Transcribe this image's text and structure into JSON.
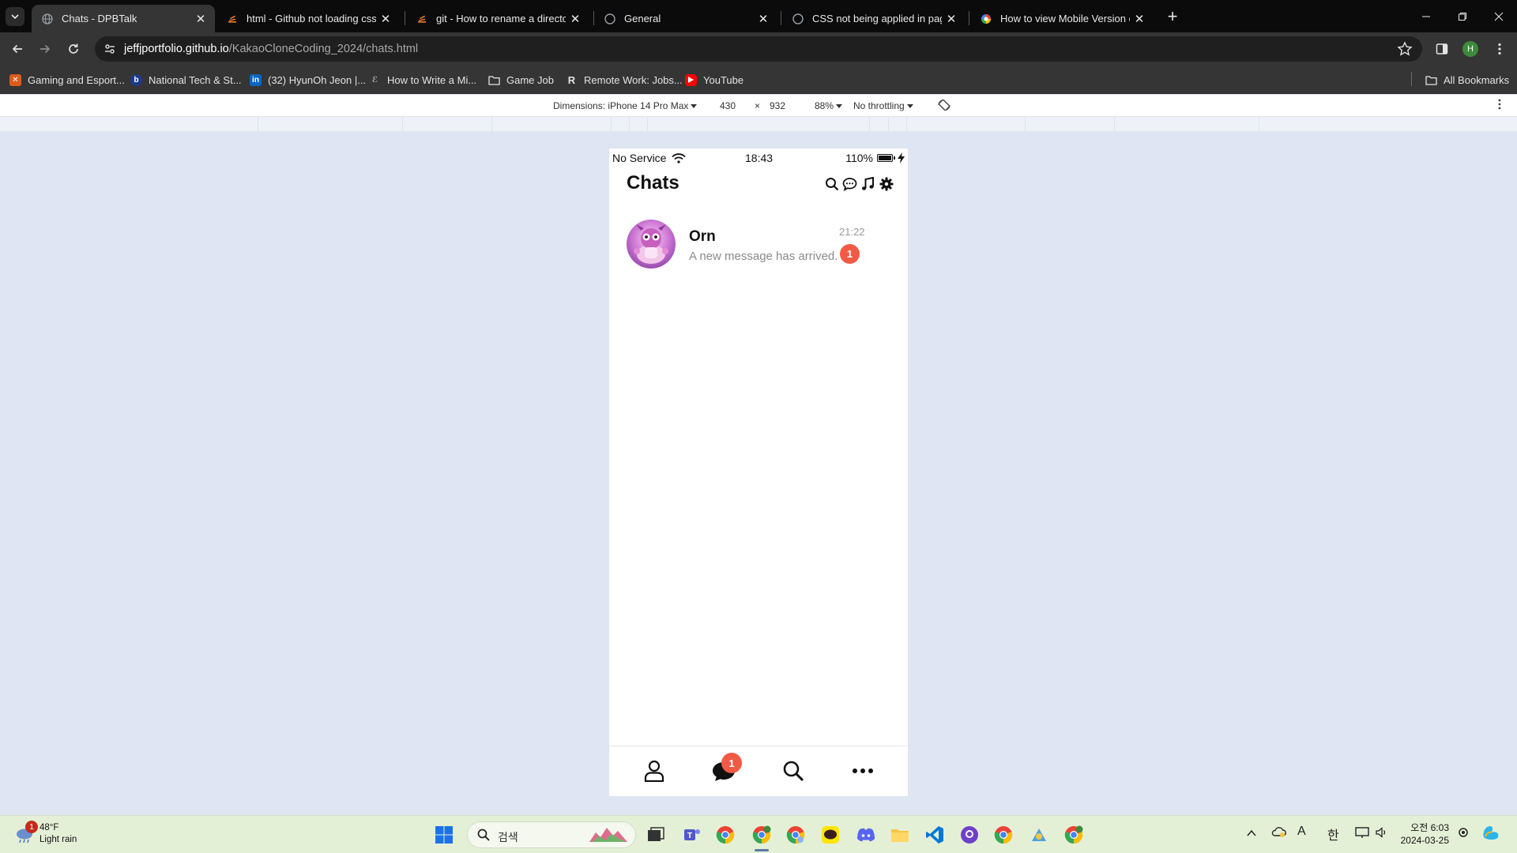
{
  "browser": {
    "tabs": [
      {
        "title": "Chats - DPBTalk",
        "active": true
      },
      {
        "title": "html - Github not loading css",
        "active": false
      },
      {
        "title": "git - How to rename a directo",
        "active": false
      },
      {
        "title": "General",
        "active": false
      },
      {
        "title": "CSS not being applied in page",
        "active": false
      },
      {
        "title": "How to view Mobile Version o",
        "active": false
      }
    ],
    "url_host": "jeffjportfolio.github.io",
    "url_path": "/KakaoCloneCoding_2024/chats.html",
    "profile_initial": "H",
    "bookmarks": [
      {
        "label": "Gaming and Esport..."
      },
      {
        "label": "National Tech & St..."
      },
      {
        "label": "(32) HyunOh Jeon |..."
      },
      {
        "label": "How to Write a Mi..."
      },
      {
        "label": "Game Job"
      },
      {
        "label": "Remote Work: Jobs..."
      },
      {
        "label": "YouTube"
      }
    ],
    "all_bookmarks": "All Bookmarks"
  },
  "devtools": {
    "dimensions_label": "Dimensions: iPhone 14 Pro Max",
    "width": "430",
    "times": "×",
    "height": "932",
    "zoom": "88%",
    "throttling": "No throttling"
  },
  "phone": {
    "status": {
      "carrier": "No Service",
      "time": "18:43",
      "battery": "110%"
    },
    "screen_title": "Chats",
    "chats": [
      {
        "name": "Orn",
        "preview": "A new message has arrived.",
        "time": "21:22",
        "unread": "1"
      }
    ],
    "tabbar_badge": "1",
    "colors": {
      "badge": "#f15a45"
    }
  },
  "taskbar": {
    "weather_temp": "48°F",
    "weather_desc": "Light rain",
    "weather_badge": "1",
    "search_placeholder": "검색",
    "ime_a": "A",
    "ime_han": "한",
    "clock_ampm_time": "오전 6:03",
    "clock_date": "2024-03-25"
  }
}
